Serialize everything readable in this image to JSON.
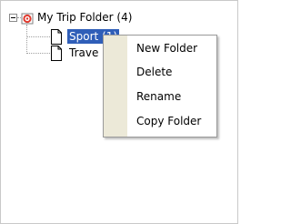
{
  "tree": {
    "root": {
      "label": "My Trip Folder (4)",
      "icon": "red-target-folder-icon"
    },
    "children": [
      {
        "label": "Sport (1)",
        "icon": "document-icon",
        "selected": true
      },
      {
        "label": "Trave",
        "icon": "document-icon",
        "selected": false
      }
    ]
  },
  "context_menu": {
    "items": [
      {
        "label": "New Folder"
      },
      {
        "label": "Delete"
      },
      {
        "label": "Rename"
      },
      {
        "label": "Copy Folder"
      }
    ]
  }
}
